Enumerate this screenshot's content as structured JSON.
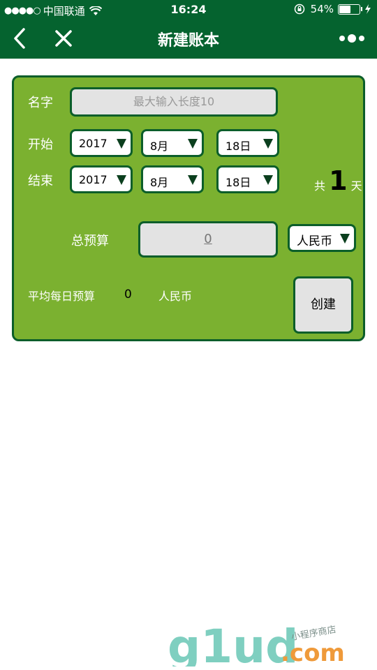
{
  "status": {
    "carrier": "中国联通",
    "time": "16:24",
    "battery": "54%",
    "battery_level": 0.54
  },
  "nav": {
    "title": "新建账本",
    "icons": [
      "back-icon",
      "close-icon",
      "more-icon"
    ]
  },
  "form": {
    "name_label": "名字",
    "name_placeholder": "最大输入长度10",
    "start_label": "开始",
    "end_label": "结束",
    "start": {
      "year": "2017",
      "month": "8月",
      "day": "18日"
    },
    "end": {
      "year": "2017",
      "month": "8月",
      "day": "18日"
    },
    "days_prefix": "共",
    "days_value": "1",
    "days_suffix": "天",
    "budget_label": "总预算",
    "budget_value": "0",
    "currency": "人民币",
    "daily_label": "平均每日预算",
    "daily_value": "0",
    "daily_currency": "人民币",
    "create_label": "创建"
  },
  "watermark": {
    "logo": "g1ud",
    "subtitle": "小程序商店",
    "suffix": ".com"
  },
  "colors": {
    "nav_bg": "#05632f",
    "card_bg": "#7bb130",
    "card_border": "#0b5e2a",
    "input_bg": "#e3e3e3"
  }
}
